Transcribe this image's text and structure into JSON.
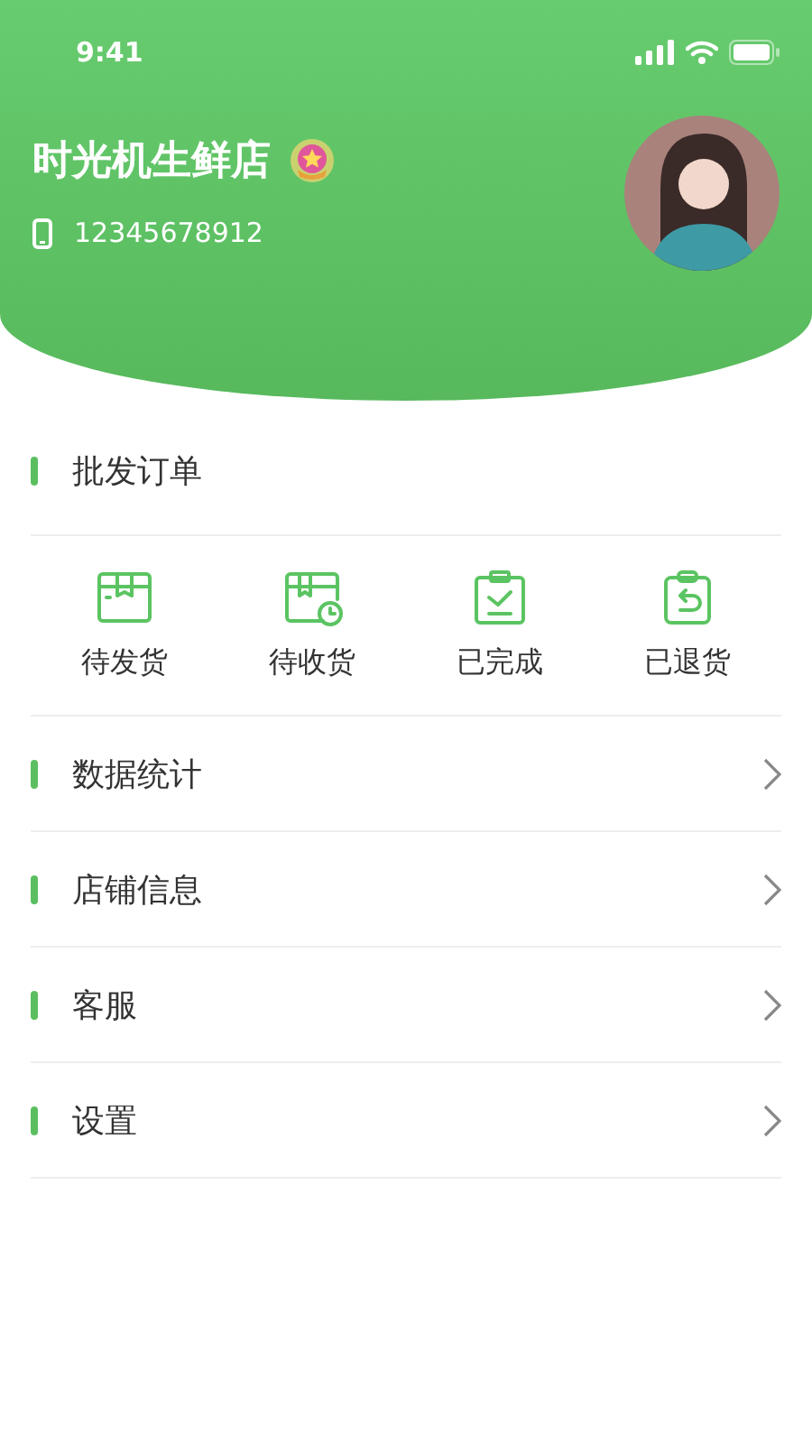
{
  "status_bar": {
    "time": "9:41"
  },
  "profile": {
    "shop_name": "时光机生鲜店",
    "phone": "12345678912"
  },
  "order_section": {
    "title": "批发订单",
    "items": [
      {
        "label": "待发货",
        "kind": "box"
      },
      {
        "label": "待收货",
        "kind": "clock"
      },
      {
        "label": "已完成",
        "kind": "check"
      },
      {
        "label": "已退货",
        "kind": "return"
      }
    ]
  },
  "menu": [
    {
      "label": "数据统计"
    },
    {
      "label": "店铺信息"
    },
    {
      "label": "客服"
    },
    {
      "label": "设置"
    }
  ]
}
